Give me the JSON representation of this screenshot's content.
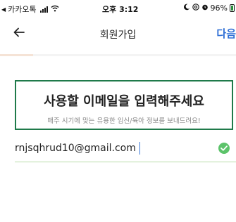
{
  "status_bar": {
    "back_app": "카카오톡",
    "time": "오후 3:12",
    "battery_percent": "96%",
    "icons": [
      "back-triangle-icon",
      "signal-icon",
      "wifi-icon",
      "moon-icon",
      "at-icon",
      "alarm-icon",
      "battery-icon"
    ]
  },
  "nav": {
    "title": "회원가입",
    "next_label": "다음",
    "back_icon": "arrow-left-icon"
  },
  "progress": {
    "fraction": 0.14
  },
  "prompt": {
    "title": "사용할 이메일을 입력해주세요",
    "subtitle": "매주 시기에 맞는 유용한 임신/육아 정보를 보내드려요!"
  },
  "email": {
    "value": "rnjsqhrud10@gmail.com",
    "valid": true,
    "status_icon": "check-circle-icon"
  },
  "colors": {
    "accent_blue": "#2f6fd6",
    "box_border_green": "#1f7a4a",
    "valid_green": "#5cc36a",
    "underline_green": "#b9dca8",
    "progress_fill": "#f5e3d6"
  }
}
